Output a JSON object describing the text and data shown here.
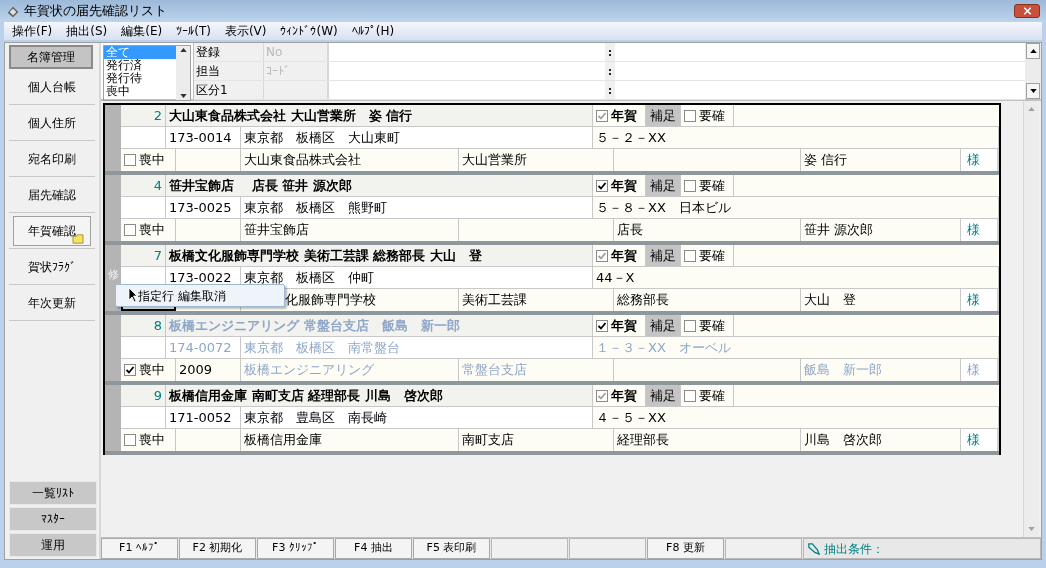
{
  "window": {
    "title": "年賀状の届先確認リスト"
  },
  "menu": [
    "操作(F)",
    "抽出(S)",
    "編集(E)",
    "ﾂｰﾙ(T)",
    "表示(V)",
    "ｳｨﾝﾄﾞｳ(W)",
    "ﾍﾙﾌﾟ(H)"
  ],
  "sidebar": {
    "items": [
      {
        "label": "名簿管理",
        "kind": "header",
        "selected": false
      },
      {
        "label": "個人台帳",
        "kind": "nav",
        "selected": false
      },
      {
        "label": "個人住所",
        "kind": "nav",
        "selected": false
      },
      {
        "label": "宛名印刷",
        "kind": "nav",
        "selected": false
      },
      {
        "label": "届先確認",
        "kind": "nav",
        "selected": false
      },
      {
        "label": "年賀確認",
        "kind": "nav",
        "selected": true
      },
      {
        "label": "賀状ﾌﾗｸﾞ",
        "kind": "nav",
        "selected": false
      },
      {
        "label": "年次更新",
        "kind": "nav",
        "selected": false
      }
    ],
    "bottom_items": [
      "一覧ﾘｽﾄ",
      "ﾏｽﾀｰ",
      "運用"
    ]
  },
  "filter": {
    "status_list": [
      {
        "label": "全て",
        "selected": true
      },
      {
        "label": "発行済",
        "selected": false
      },
      {
        "label": "発行待",
        "selected": false
      },
      {
        "label": "喪中",
        "selected": false
      }
    ],
    "fields": [
      {
        "label": "登録",
        "placeholder": "No",
        "separator": ":"
      },
      {
        "label": "担当",
        "placeholder": "ｺｰﾄﾞ",
        "separator": ":"
      },
      {
        "label": "区分1",
        "separator": ":"
      }
    ]
  },
  "records": [
    {
      "number": "2",
      "name": "大山東食品株式会社 大山営業所　姿 信行",
      "nenga": {
        "label": "年賀",
        "checked": true,
        "disabled": true
      },
      "supplement": "補足",
      "confirm": {
        "label": "要確",
        "checked": false
      },
      "postcode": "173-0014",
      "address": "東京都　板橋区　大山東町",
      "banchi": "５－２－XX",
      "mochu": {
        "label": "喪中",
        "checked": false
      },
      "company": "大山東食品株式会社",
      "department": "大山営業所",
      "person": "姿 信行",
      "honorific": "様",
      "dimmed": false
    },
    {
      "number": "4",
      "name": "笹井宝飾店　 店長 笹井 源次郎",
      "nenga": {
        "label": "年賀",
        "checked": true,
        "disabled": false
      },
      "supplement": "補足",
      "confirm": {
        "label": "要確",
        "checked": false
      },
      "postcode": "173-0025",
      "address": "東京都　板橋区　熊野町",
      "banchi": "５－８－XX　日本ビル",
      "mochu": {
        "label": "喪中",
        "checked": false
      },
      "company": "笹井宝飾店",
      "title": "店長",
      "person": "笹井 源次郎",
      "honorific": "様",
      "dimmed": false
    },
    {
      "number": "7",
      "edit_mark": "修",
      "name": "板橋文化服飾専門学校 美術工芸課 総務部長 大山　登",
      "nenga": {
        "label": "年賀",
        "checked": true,
        "disabled": true
      },
      "supplement": "補足",
      "confirm": {
        "label": "要確",
        "checked": false
      },
      "postcode": "173-0022",
      "address": "東京都　板橋区　仲町",
      "banchi": "44－X",
      "focused": true,
      "context_menu": {
        "item": "指定行 編集取消"
      },
      "company": "化服飾専門学校",
      "department": "美術工芸課",
      "title": "総務部長",
      "person": "大山　登",
      "honorific": "様",
      "dimmed": false
    },
    {
      "number": "8",
      "name": "板橋エンジニアリング 常盤台支店　飯島　新一郎",
      "nenga": {
        "label": "年賀",
        "checked": true,
        "disabled": false
      },
      "supplement": "補足",
      "confirm": {
        "label": "要確",
        "checked": false
      },
      "postcode": "174-0072",
      "address": "東京都　板橋区　南常盤台",
      "banchi": "１－３－XX　オーベル",
      "mochu": {
        "label": "喪中",
        "checked": true
      },
      "year": "2009",
      "company": "板橋エンジニアリング",
      "department": "常盤台支店",
      "person": "飯島　新一郎",
      "honorific": "様",
      "dimmed": true
    },
    {
      "number": "9",
      "name": "板橋信用金庫 南町支店 経理部長 川島　啓次郎",
      "nenga": {
        "label": "年賀",
        "checked": true,
        "disabled": true
      },
      "supplement": "補足",
      "confirm": {
        "label": "要確",
        "checked": false
      },
      "postcode": "171-0052",
      "address": "東京都　豊島区　南長崎",
      "banchi": "４－５－XX",
      "mochu": {
        "label": "喪中",
        "checked": false
      },
      "company": "板橋信用金庫",
      "department": "南町支店",
      "title": "経理部長",
      "person": "川島　啓次郎",
      "honorific": "様",
      "dimmed": false
    }
  ],
  "function_keys": [
    {
      "kind": "key",
      "label": "F1 ﾍﾙﾌﾟ"
    },
    {
      "kind": "key",
      "label": "F2 初期化"
    },
    {
      "kind": "key",
      "label": "F3 ｸﾘｯﾌﾟ"
    },
    {
      "kind": "key",
      "label": "F4 抽出"
    },
    {
      "kind": "key",
      "label": "F5 表印刷"
    },
    {
      "kind": "blank"
    },
    {
      "kind": "blank"
    },
    {
      "kind": "key",
      "label": "F8 更新"
    },
    {
      "kind": "blank"
    }
  ],
  "status": {
    "label": "抽出条件："
  }
}
